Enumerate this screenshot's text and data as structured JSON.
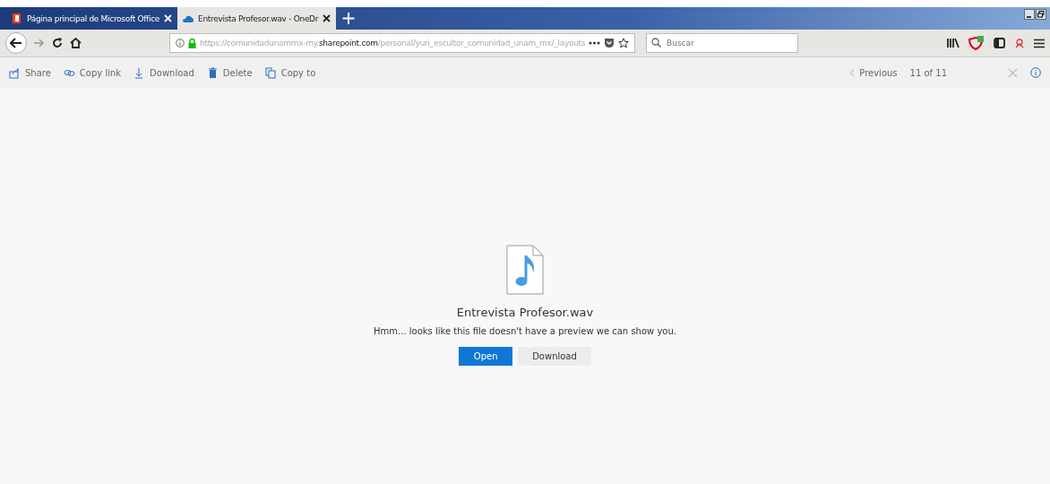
{
  "tabs": [
    {
      "label": "Página principal de Microsoft Office",
      "selected": false
    },
    {
      "label": "Entrevista Profesor.wav - OneDr",
      "selected": true
    }
  ],
  "address": {
    "prefix": "https://comunidadunammx-my.",
    "domain": "sharepoint.com",
    "path": "/personal/yuri_escultor_comunidad_unam_mx/_layouts"
  },
  "search": {
    "placeholder": "Buscar"
  },
  "toolbar": {
    "actions": [
      {
        "label": "Share"
      },
      {
        "label": "Copy link"
      },
      {
        "label": "Download"
      },
      {
        "label": "Delete"
      },
      {
        "label": "Copy to"
      }
    ],
    "previous": "Previous",
    "position": "11 of 11"
  },
  "file": {
    "name": "Entrevista Profesor.wav",
    "message": "Hmm... looks like this file doesn't have a preview we can show you.",
    "buttons": [
      {
        "label": "Open",
        "primary": true
      },
      {
        "label": "Download",
        "primary": false
      }
    ]
  }
}
